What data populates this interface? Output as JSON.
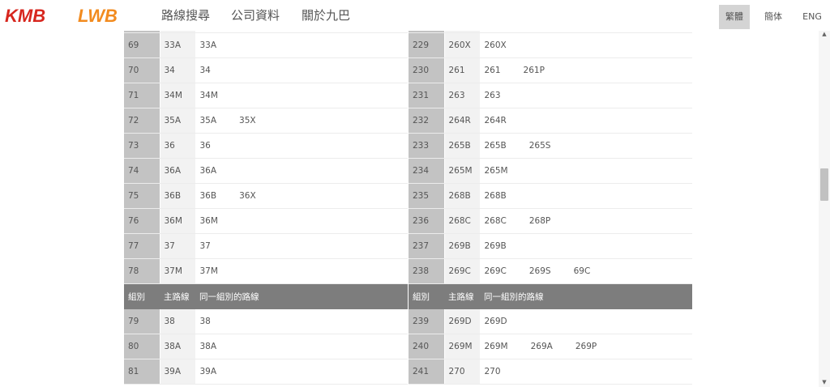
{
  "header": {
    "logos": {
      "kmb": "KMB",
      "lwb": "LWB"
    },
    "nav": [
      "路線搜尋",
      "公司資料",
      "關於九巴"
    ],
    "languages": [
      {
        "label": "繁體",
        "active": true
      },
      {
        "label": "簡体",
        "active": false
      },
      {
        "label": "ENG",
        "active": false
      }
    ]
  },
  "colors": {
    "kmb_red": "#d7261e",
    "lwb_orange": "#f28b1f",
    "header_row": "#7d7d7d"
  },
  "table": {
    "headers": [
      "組別",
      "主路線",
      "同一組別的路線"
    ],
    "left": [
      {
        "group": "",
        "main": "",
        "routes": []
      },
      {
        "group": "69",
        "main": "33A",
        "routes": [
          "33A"
        ]
      },
      {
        "group": "70",
        "main": "34",
        "routes": [
          "34"
        ]
      },
      {
        "group": "71",
        "main": "34M",
        "routes": [
          "34M"
        ]
      },
      {
        "group": "72",
        "main": "35A",
        "routes": [
          "35A",
          "35X"
        ]
      },
      {
        "group": "73",
        "main": "36",
        "routes": [
          "36"
        ]
      },
      {
        "group": "74",
        "main": "36A",
        "routes": [
          "36A"
        ]
      },
      {
        "group": "75",
        "main": "36B",
        "routes": [
          "36B",
          "36X"
        ]
      },
      {
        "group": "76",
        "main": "36M",
        "routes": [
          "36M"
        ]
      },
      {
        "group": "77",
        "main": "37",
        "routes": [
          "37"
        ]
      },
      {
        "group": "78",
        "main": "37M",
        "routes": [
          "37M"
        ]
      },
      {
        "header": true
      },
      {
        "group": "79",
        "main": "38",
        "routes": [
          "38"
        ]
      },
      {
        "group": "80",
        "main": "38A",
        "routes": [
          "38A"
        ]
      },
      {
        "group": "81",
        "main": "39A",
        "routes": [
          "39A"
        ]
      }
    ],
    "right": [
      {
        "group": "",
        "main": "",
        "routes": []
      },
      {
        "group": "229",
        "main": "260X",
        "routes": [
          "260X"
        ]
      },
      {
        "group": "230",
        "main": "261",
        "routes": [
          "261",
          "261P"
        ]
      },
      {
        "group": "231",
        "main": "263",
        "routes": [
          "263"
        ]
      },
      {
        "group": "232",
        "main": "264R",
        "routes": [
          "264R"
        ]
      },
      {
        "group": "233",
        "main": "265B",
        "routes": [
          "265B",
          "265S"
        ]
      },
      {
        "group": "234",
        "main": "265M",
        "routes": [
          "265M"
        ]
      },
      {
        "group": "235",
        "main": "268B",
        "routes": [
          "268B"
        ]
      },
      {
        "group": "236",
        "main": "268C",
        "routes": [
          "268C",
          "268P"
        ]
      },
      {
        "group": "237",
        "main": "269B",
        "routes": [
          "269B"
        ]
      },
      {
        "group": "238",
        "main": "269C",
        "routes": [
          "269C",
          "269S",
          "69C"
        ]
      },
      {
        "header": true
      },
      {
        "group": "239",
        "main": "269D",
        "routes": [
          "269D"
        ]
      },
      {
        "group": "240",
        "main": "269M",
        "routes": [
          "269M",
          "269A",
          "269P"
        ]
      },
      {
        "group": "241",
        "main": "270",
        "routes": [
          "270"
        ]
      }
    ]
  },
  "scrollbar": {
    "position": 0.42
  }
}
